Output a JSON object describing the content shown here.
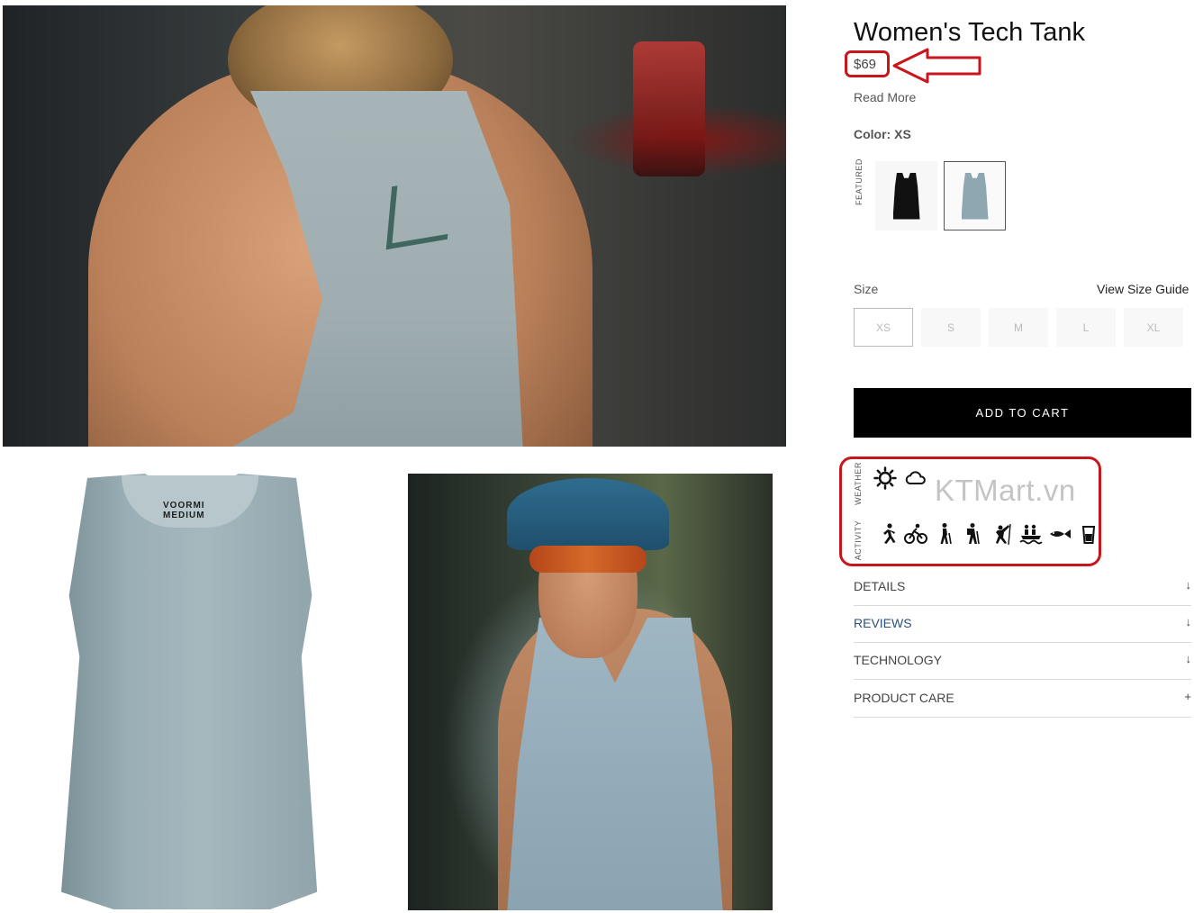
{
  "product": {
    "title": "Women's Tech Tank",
    "price": "$69",
    "read_more": "Read More",
    "color_label": "Color: XS",
    "featured_tag": "FEATURED",
    "swatches": [
      "black",
      "light-blue"
    ]
  },
  "gallery": {
    "product_label": "VOORMI",
    "product_size": "MEDIUM"
  },
  "size": {
    "label": "Size",
    "guide": "View Size Guide",
    "options": [
      "XS",
      "S",
      "M",
      "L",
      "XL"
    ],
    "selected": "XS"
  },
  "cart": {
    "label": "ADD TO CART"
  },
  "conditions": {
    "weather_tag": "WEATHER",
    "activity_tag": "ACTIVITY",
    "weather_icons": [
      "sun-icon",
      "cloud-icon"
    ],
    "activity_icons": [
      "running-icon",
      "cycling-icon",
      "walking-icon",
      "hiking-icon",
      "climbing-icon",
      "rafting-icon",
      "fishing-icon",
      "drink-icon"
    ]
  },
  "watermark": "KTMart.vn",
  "accordions": [
    {
      "label": "DETAILS",
      "icon": "↓"
    },
    {
      "label": "REVIEWS",
      "icon": "↓"
    },
    {
      "label": "TECHNOLOGY",
      "icon": "↓"
    },
    {
      "label": "PRODUCT CARE",
      "icon": "+"
    }
  ],
  "colors": {
    "annotation": "#c8161d",
    "cart_bg": "#000000",
    "reviews_link": "#2d4f7c"
  }
}
